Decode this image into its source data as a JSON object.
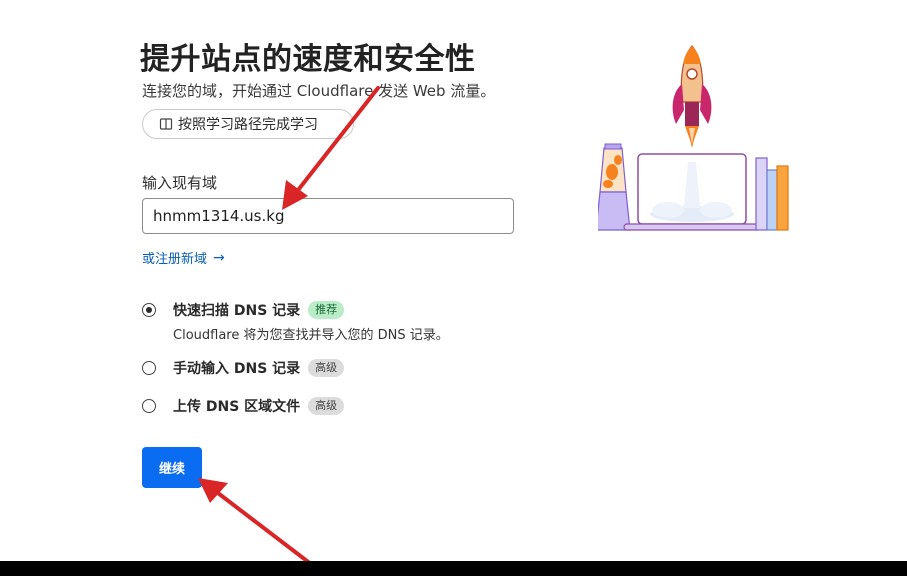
{
  "header": {
    "title": "提升站点的速度和安全性",
    "subtitle": "连接您的域，开始通过 Cloudflare 发送 Web 流量。"
  },
  "learn_button": {
    "label": "按照学习路径完成学习",
    "icon": "book-icon"
  },
  "domain_field": {
    "label": "输入现有域",
    "value": "hnmm1314.us.kg"
  },
  "register_link": {
    "label": "或注册新域",
    "icon": "arrow-right-icon"
  },
  "dns_options": [
    {
      "title": "快速扫描 DNS 记录",
      "badge": "推荐",
      "description": "Cloudflare 将为您查找并导入您的 DNS 记录。",
      "selected": true
    },
    {
      "title": "手动输入 DNS 记录",
      "badge": "高级",
      "selected": false
    },
    {
      "title": "上传 DNS 区域文件",
      "badge": "高级",
      "selected": false
    }
  ],
  "continue_button": {
    "label": "继续"
  },
  "colors": {
    "primary": "#0a6cf0",
    "link": "#0a5fb4",
    "badge_recommended": "#b9ecc7",
    "badge_advanced": "#dcdcdc",
    "annotation_arrow": "#d92525"
  },
  "icons": {
    "illustration": "rocket-laptop-illustration"
  }
}
